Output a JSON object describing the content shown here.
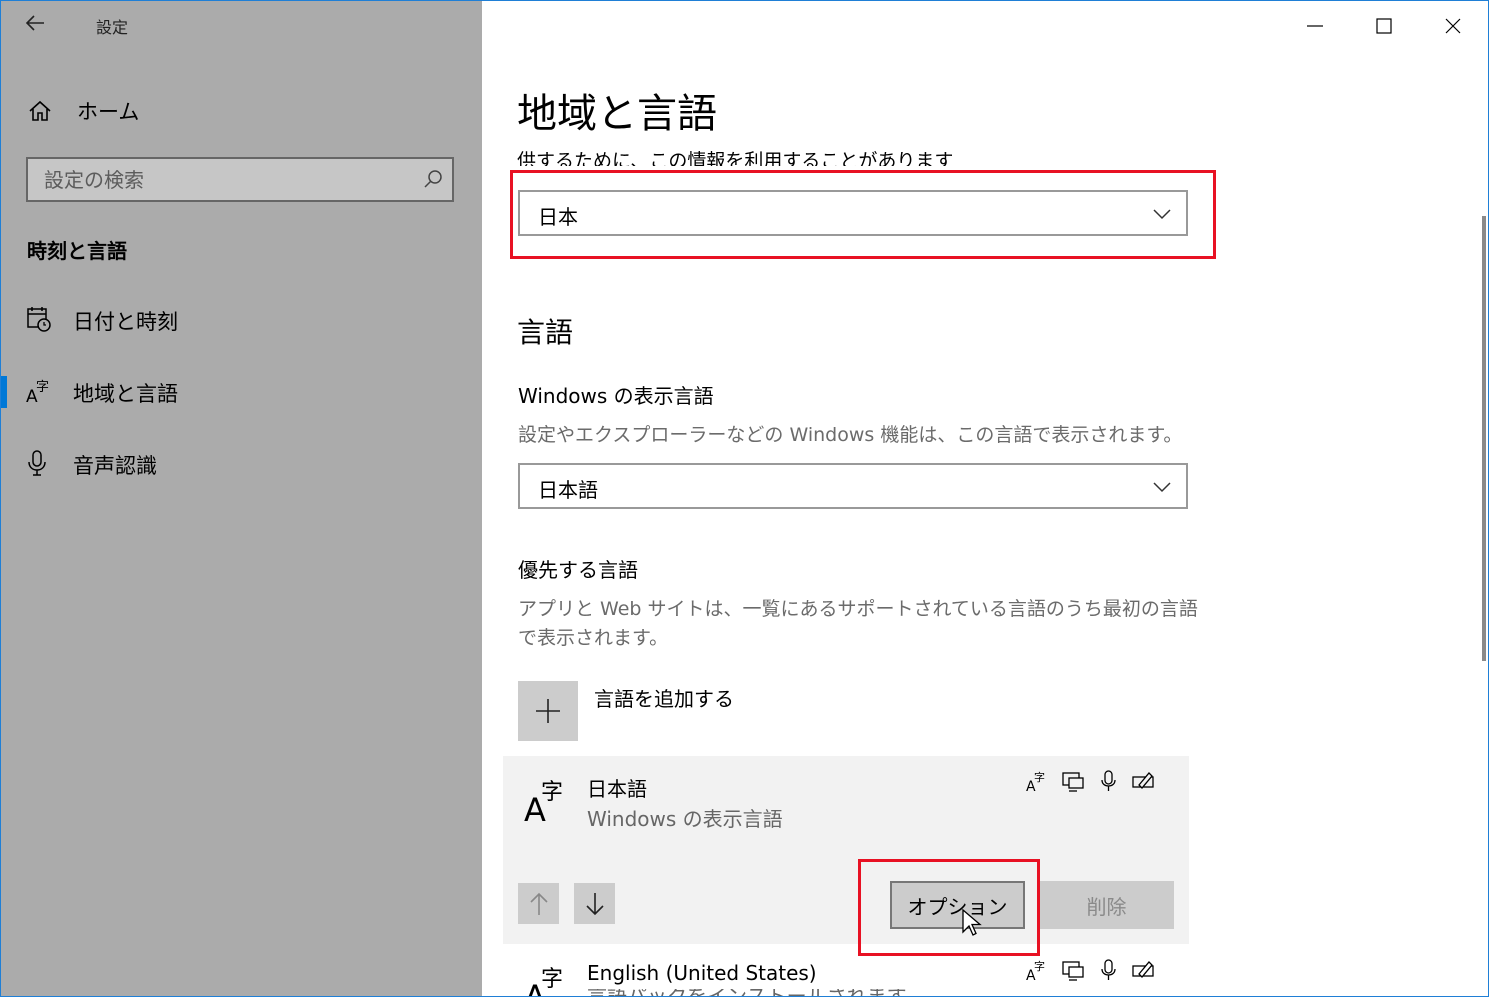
{
  "app": {
    "title": "設定"
  },
  "sidebar": {
    "home_label": "ホーム",
    "search_placeholder": "設定の検索",
    "section_heading": "時刻と言語",
    "items": [
      {
        "label": "日付と時刻",
        "icon": "calendar-clock-icon",
        "selected": false
      },
      {
        "label": "地域と言語",
        "icon": "language-icon",
        "selected": true
      },
      {
        "label": "音声認識",
        "icon": "microphone-icon",
        "selected": false
      }
    ]
  },
  "main": {
    "page_title": "地域と言語",
    "region_partial_text": "供するために、この情報を利用することがあります",
    "region_dropdown_value": "日本",
    "language_heading": "言語",
    "display_language": {
      "heading": "Windows の表示言語",
      "description": "設定やエクスプローラーなどの Windows 機能は、この言語で表示されます。",
      "value": "日本語"
    },
    "preferred": {
      "heading": "優先する言語",
      "description_line1": "アプリと Web サイトは、一覧にあるサポートされている言語のうち最初の言語",
      "description_line2": "で表示されます。",
      "add_label": "言語を追加する"
    },
    "languages": [
      {
        "name": "日本語",
        "sub": "Windows の表示言語"
      },
      {
        "name": "English (United States)",
        "sub": "言語パックをインストールされます"
      }
    ],
    "options_button": "オプション",
    "delete_button": "削除"
  },
  "colors": {
    "accent": "#0078d7",
    "highlight": "#e81123",
    "sidebar_bg": "#ababab"
  }
}
